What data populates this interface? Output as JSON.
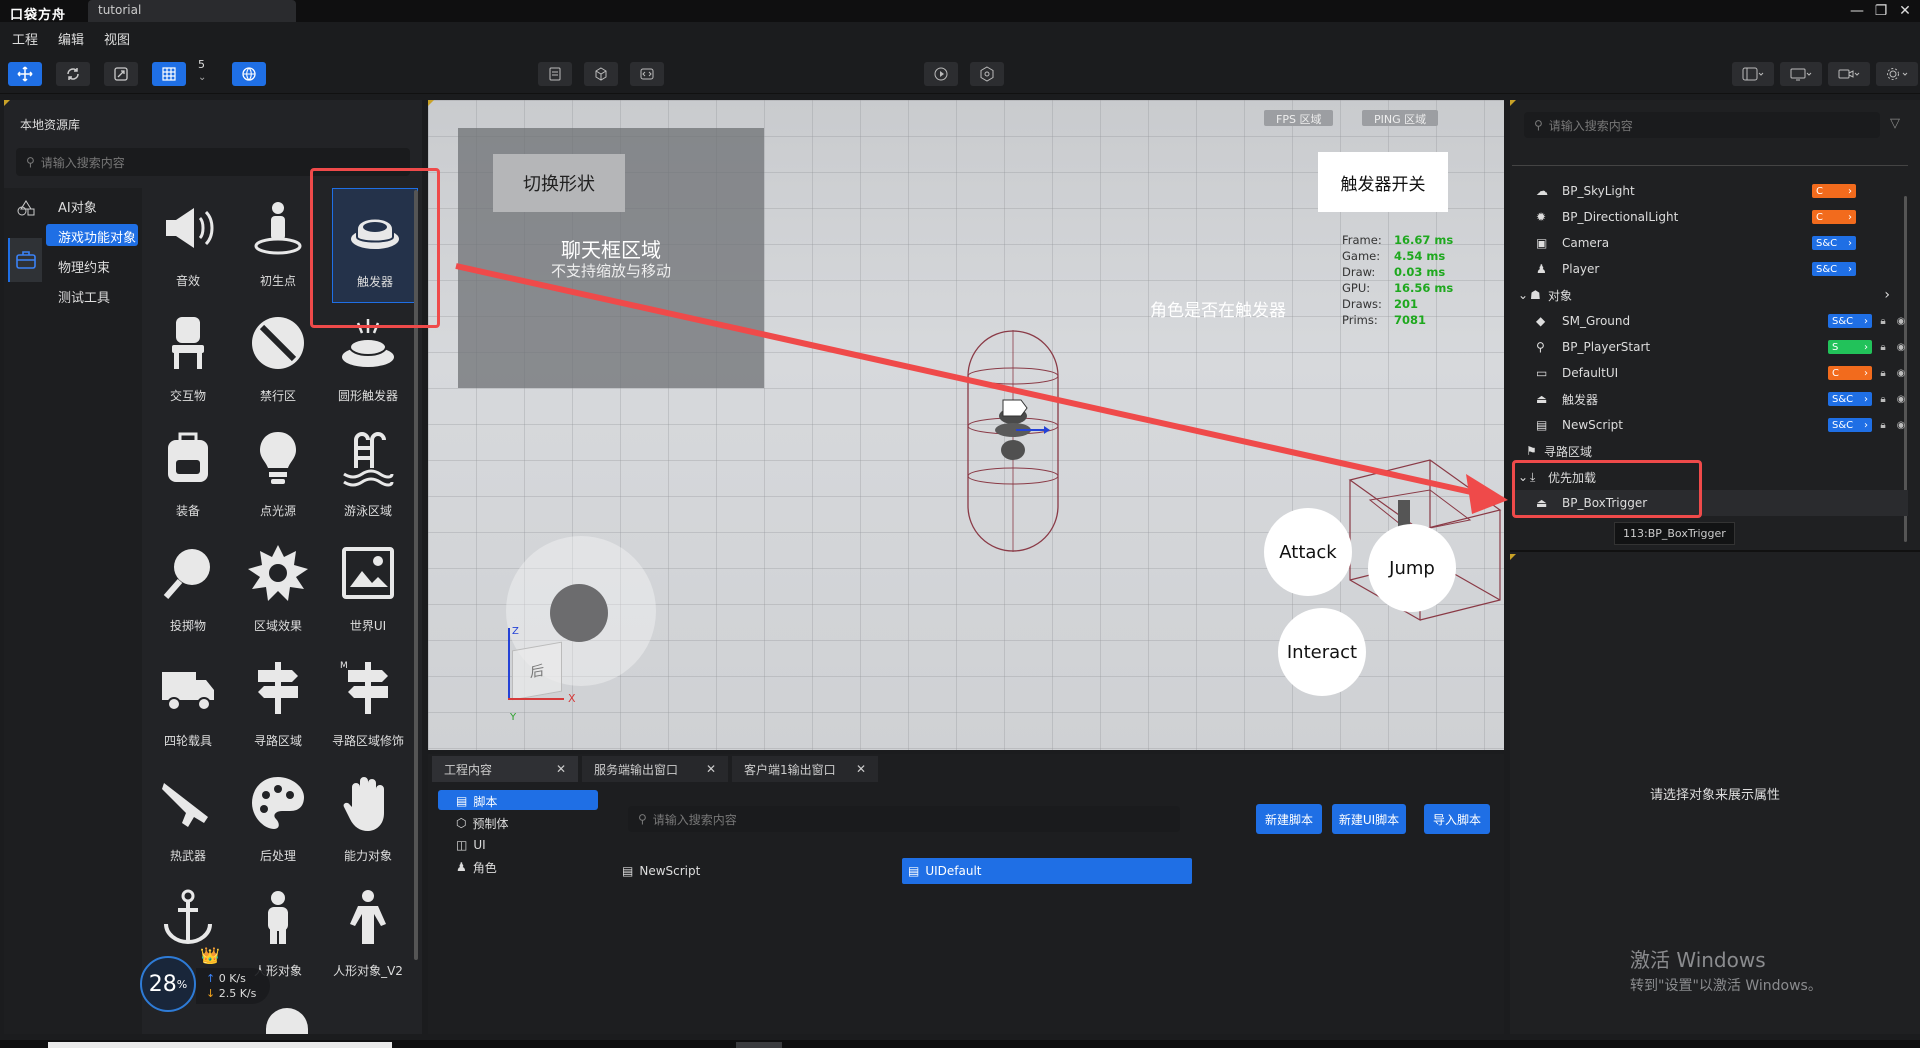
{
  "window": {
    "logo": "口袋方舟",
    "tab": "tutorial",
    "controls": [
      "—",
      "❐",
      "✕"
    ]
  },
  "menu": {
    "items": [
      "工程",
      "编辑",
      "视图"
    ]
  },
  "toolbar": {
    "snap_value": "5"
  },
  "asset_library": {
    "title": "本地资源库",
    "search_placeholder": "请输入搜索内容",
    "categories": [
      "AI对象",
      "游戏功能对象",
      "物理约束",
      "测试工具"
    ],
    "selected_category": "游戏功能对象",
    "assets": [
      {
        "label": "音效",
        "icon": "sound-icon"
      },
      {
        "label": "初生点",
        "icon": "spawn-point-icon"
      },
      {
        "label": "触发器",
        "icon": "trigger-icon"
      },
      {
        "label": "交互物",
        "icon": "interactive-chair-icon"
      },
      {
        "label": "禁行区",
        "icon": "no-entry-icon"
      },
      {
        "label": "圆形触发器",
        "icon": "round-trigger-icon"
      },
      {
        "label": "装备",
        "icon": "backpack-icon"
      },
      {
        "label": "点光源",
        "icon": "light-bulb-icon"
      },
      {
        "label": "游泳区域",
        "icon": "pool-ladder-icon"
      },
      {
        "label": "投掷物",
        "icon": "throwable-icon"
      },
      {
        "label": "区域效果",
        "icon": "area-effect-icon"
      },
      {
        "label": "世界UI",
        "icon": "world-ui-icon"
      },
      {
        "label": "四轮载具",
        "icon": "truck-icon"
      },
      {
        "label": "寻路区域",
        "icon": "signpost-icon"
      },
      {
        "label": "寻路区域修饰",
        "icon": "signpost-modifier-icon"
      },
      {
        "label": "热武器",
        "icon": "gun-icon"
      },
      {
        "label": "后处理",
        "icon": "palette-icon"
      },
      {
        "label": "能力对象",
        "icon": "hand-icon"
      },
      {
        "label": "",
        "icon": "anchor-icon"
      },
      {
        "label": "人形对象",
        "icon": "humanoid-icon"
      },
      {
        "label": "人形对象_V2",
        "icon": "humanoid-v2-icon"
      }
    ]
  },
  "viewport": {
    "fps_tag": "FPS 区域",
    "ping_tag": "PING 区域",
    "switch_shape": "切换形状",
    "chat_title": "聊天框区域",
    "chat_subtitle": "不支持缩放与移动",
    "trigger_switch": "触发器开关",
    "trigger_status": "角色是否在触发器",
    "stats": [
      {
        "k": "Frame:",
        "v": "16.67 ms"
      },
      {
        "k": "Game:",
        "v": "4.54 ms"
      },
      {
        "k": "Draw:",
        "v": "0.03 ms"
      },
      {
        "k": "GPU:",
        "v": "16.56 ms"
      },
      {
        "k": "Draws:",
        "v": "201"
      },
      {
        "k": "Prims:",
        "v": "7081"
      }
    ],
    "buttons": {
      "attack": "Attack",
      "jump": "Jump",
      "interact": "Interact"
    },
    "gizmo_back": "后",
    "axis_x": "X",
    "axis_z": "Z",
    "axis_y": "Y"
  },
  "bottom": {
    "tabs": [
      "工程内容",
      "服务端输出窗口",
      "客户端1输出窗口"
    ],
    "tree": [
      "脚本",
      "预制体",
      "UI",
      "角色"
    ],
    "search_placeholder": "请输入搜索内容",
    "buttons": [
      "新建脚本",
      "新建UI脚本",
      "导入脚本"
    ],
    "files": [
      "NewScript",
      "UIDefault"
    ]
  },
  "scene": {
    "search_placeholder": "请输入搜索内容",
    "rows_top": [
      {
        "name": "BP_SkyLight",
        "badge": "C",
        "color": "#f26b1d"
      },
      {
        "name": "BP_DirectionalLight",
        "badge": "C",
        "color": "#f26b1d"
      },
      {
        "name": "Camera",
        "badge": "S&C",
        "color": "#1f6fe5"
      },
      {
        "name": "Player",
        "badge": "S&C",
        "color": "#1f6fe5"
      }
    ],
    "group_objects": "对象",
    "rows_objects": [
      {
        "name": "SM_Ground",
        "badge": "S&C",
        "color": "#1f6fe5"
      },
      {
        "name": "BP_PlayerStart",
        "badge": "S",
        "color": "#22c25a"
      },
      {
        "name": "DefaultUI",
        "badge": "C",
        "color": "#f26b1d"
      },
      {
        "name": "触发器",
        "badge": "S&C",
        "color": "#1f6fe5"
      },
      {
        "name": "NewScript",
        "badge": "S&C",
        "color": "#1f6fe5"
      }
    ],
    "nav_area": "寻路区域",
    "priority_group": "优先加载",
    "priority_item": "BP_BoxTrigger",
    "tooltip": "113:BP_BoxTrigger",
    "props_empty": "请选择对象来展示属性"
  },
  "net": {
    "percent": "28",
    "unit": "%",
    "up": "0 K/s",
    "down": "2.5 K/s"
  },
  "activate_windows": {
    "line1": "激活 Windows",
    "line2": "转到\"设置\"以激活 Windows。"
  }
}
